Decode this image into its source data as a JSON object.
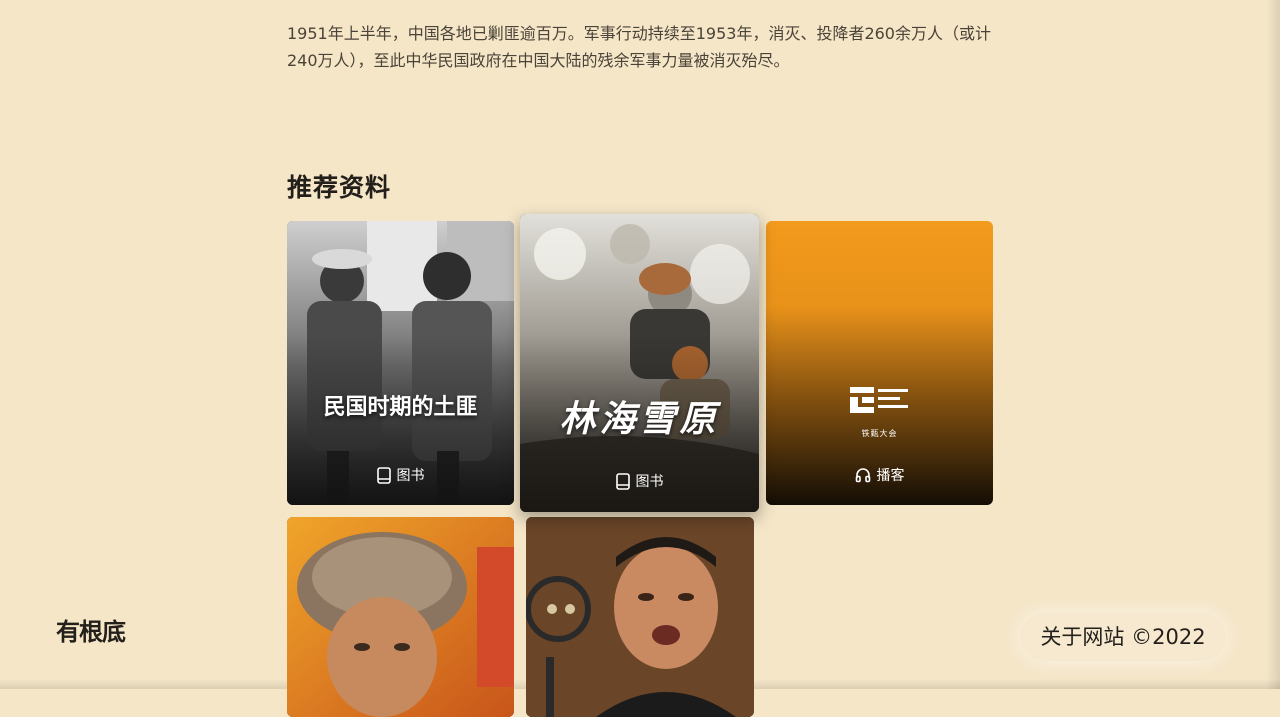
{
  "intro": {
    "text": "1951年上半年，中国各地已剿匪逾百万。军事行动持续至1953年，消灭、投降者260余万人（或计240万人），至此中华民国政府在中国大陆的残余军事力量被消灭殆尽。"
  },
  "section": {
    "title": "推荐资料"
  },
  "cards": [
    {
      "title": "民国时期的土匪",
      "type_label": "图书",
      "type_icon": "book-icon"
    },
    {
      "title": "林海雪原",
      "type_label": "图书",
      "type_icon": "book-icon"
    },
    {
      "title": "",
      "type_label": "播客",
      "type_icon": "headphones-icon",
      "logo_text": "铁甄大会"
    },
    {
      "title": "",
      "type_label": ""
    },
    {
      "title": "",
      "type_label": ""
    }
  ],
  "footer": {
    "logo_text": "有根底",
    "about": "关于网站 ©2022"
  },
  "colors": {
    "background": "#f5e6c8",
    "podcast_orange": "#f29a1c",
    "text": "#231f1a"
  }
}
